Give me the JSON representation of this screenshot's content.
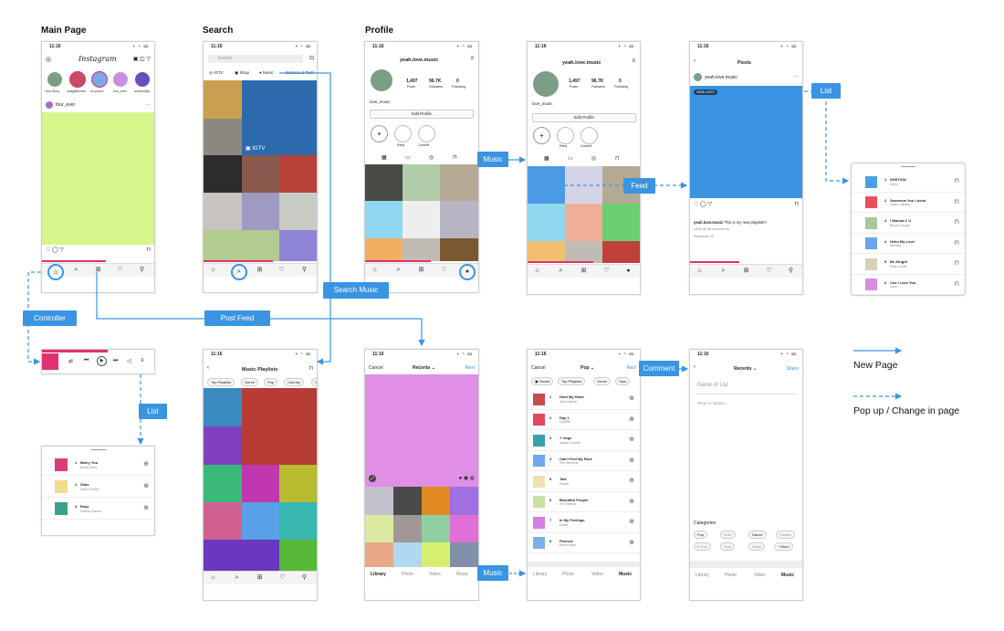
{
  "titles": {
    "main": "Main Page",
    "search": "Search",
    "profile": "Profile"
  },
  "time": "11:16",
  "main": {
    "logo": "Instagram",
    "stories": [
      "Your Story",
      "osagetjennan",
      "en.yoooo",
      "four_ever",
      "another@y"
    ],
    "post_user": "four_ever",
    "more": "···"
  },
  "search": {
    "placeholder": "Search",
    "tabs": [
      "IGTV",
      "Shop",
      "Music",
      "Science & Tech"
    ],
    "igtv": "IGTV"
  },
  "profile": {
    "username": "yeah.love.music",
    "posts": "1,497",
    "posts_l": "Posts",
    "followers": "96.7K",
    "followers_l": "Followers",
    "following": "0",
    "following_l": "Following",
    "name": "love_music",
    "edit": "Edit Profile",
    "hl1": "Party",
    "hl2": "Concert"
  },
  "posts_screen": {
    "title": "Posts",
    "user": "yeah.love.music",
    "view": "VIEW LISTS",
    "caption_user": "yeah.love.music",
    "caption": "This is my new playlist!!!!",
    "comments": "View all 15 comments",
    "date": "September 15"
  },
  "list_popup": {
    "items": [
      {
        "n": "1",
        "t": "IGNITION",
        "a": "B1A4",
        "c": "#4aa0e8"
      },
      {
        "n": "2",
        "t": "Someone You Loved",
        "a": "Lewis Capaldi",
        "c": "#e8505b"
      },
      {
        "n": "3",
        "t": "I Wanna C U",
        "a": "Blood Orange",
        "c": "#a9c8a0"
      },
      {
        "n": "4",
        "t": "Hello My Love",
        "a": "Westlife",
        "c": "#6aa7ea"
      },
      {
        "n": "5",
        "t": "Be Alright",
        "a": "Dean Lewis",
        "c": "#d8d0b4"
      },
      {
        "n": "6",
        "t": "Coz I Love You",
        "a": "Lizzo",
        "c": "#d98ee0"
      }
    ]
  },
  "controller_list": {
    "items": [
      {
        "n": "1",
        "t": "Marry You",
        "a": "Bruno Mars",
        "c": "#d63f7a"
      },
      {
        "n": "2",
        "t": "Slide",
        "a": "Calvin Harris",
        "c": "#f0dc8c"
      },
      {
        "n": "3",
        "t": "Easy",
        "a": "Selena Gomez",
        "c": "#3aa08a"
      }
    ]
  },
  "music_playlists": {
    "title": "Music Playlists",
    "pills": [
      "Top Playlists",
      "Genre",
      "Pop",
      "Country",
      "C"
    ]
  },
  "recents": {
    "cancel": "Cancel",
    "title": "Recents ⌄",
    "next": "Next",
    "tabs": [
      "Library",
      "Photo",
      "Video",
      "Music"
    ]
  },
  "pop": {
    "cancel": "Cancel",
    "title": "Pop ⌄",
    "next": "Next",
    "pills": [
      "Saved",
      "Top Playlists",
      "Genre",
      "Gym"
    ],
    "songs": [
      {
        "n": "1",
        "t": "Hold My Hand",
        "a": "Jess Glynne",
        "c": "#c94b4b"
      },
      {
        "n": "2",
        "t": "Day 1",
        "a": "HONNE",
        "c": "#e04a5a"
      },
      {
        "n": "3",
        "t": "7 rings",
        "a": "Ariana Grande",
        "c": "#3aa0b0"
      },
      {
        "n": "4",
        "t": "Can't Feel My Face",
        "a": "The Weeknd",
        "c": "#6ea8f0"
      },
      {
        "n": "5",
        "t": "Talk",
        "a": "Khalid",
        "c": "#f0e0b0"
      },
      {
        "n": "6",
        "t": "Beautiful People",
        "a": "Ed Sheeran",
        "c": "#c8e0a0"
      },
      {
        "n": "7",
        "t": "In My Feelings",
        "a": "Drake",
        "c": "#d080e0"
      },
      {
        "n": "8",
        "t": "Finesse",
        "a": "Bruno Mars",
        "c": "#7ab0e8"
      }
    ],
    "tabs": [
      "Library",
      "Photo",
      "Video",
      "Music"
    ]
  },
  "caption_screen": {
    "title": "Recents ⌄",
    "share": "Share",
    "list_name": "Name of List",
    "caption": "Write a caption...",
    "cat": "Categories",
    "cats1": [
      "Pop",
      "Indie",
      "Dance",
      "Classic"
    ],
    "cats2": [
      "K-Pop",
      "Gym",
      "Study",
      "+ More"
    ],
    "tabs": [
      "Library",
      "Photo",
      "Video",
      "Music"
    ]
  },
  "labels": {
    "music1": "Music",
    "feed": "Feed",
    "list1": "List",
    "controller": "Controller",
    "post_feed": "Post Feed",
    "search_music": "Search Music",
    "list2": "List",
    "comment": "Comment",
    "music2": "Music"
  },
  "legend": {
    "new_page": "New Page",
    "popup": "Pop up / Change in page"
  }
}
